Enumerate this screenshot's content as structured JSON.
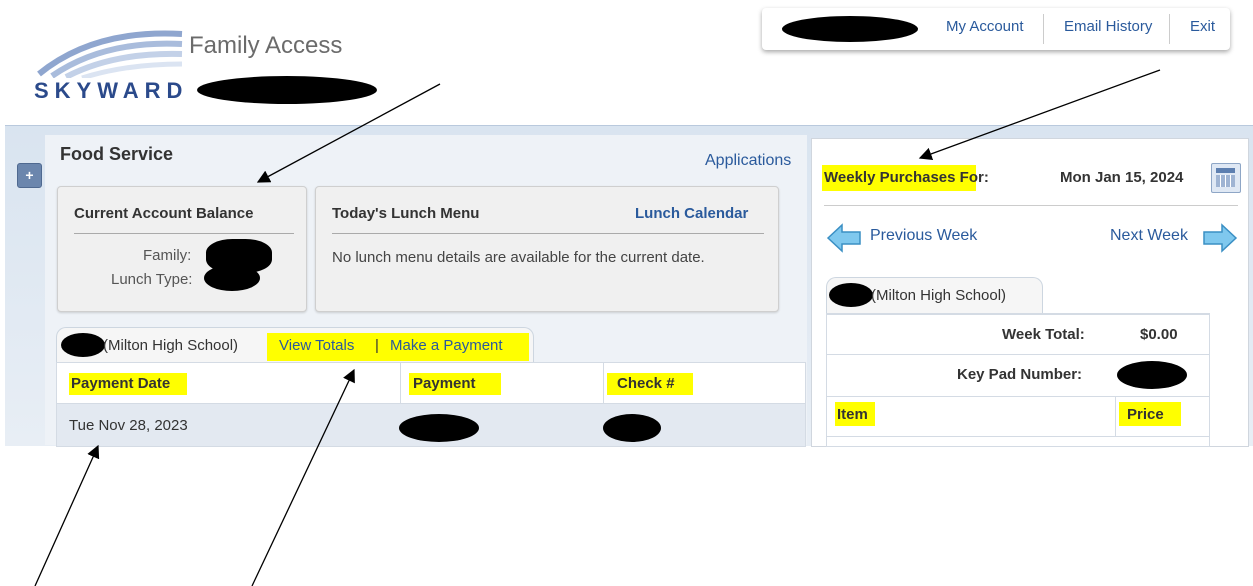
{
  "top_nav": {
    "my_account": "My Account",
    "email_history": "Email History",
    "exit": "Exit"
  },
  "brand": {
    "title": "Family Access",
    "logo": "SKYWARD"
  },
  "food_service": {
    "title": "Food Service",
    "applications_link": "Applications",
    "balance_card": {
      "title": "Current Account Balance",
      "family_label": "Family:",
      "lunch_type_label": "Lunch Type:"
    },
    "menu_card": {
      "title": "Today's Lunch Menu",
      "calendar_link": "Lunch Calendar",
      "message": "No lunch menu details are available for the current date."
    },
    "payment_tab": {
      "school": "(Milton High School)",
      "view_totals": "View Totals",
      "separator": "|",
      "make_payment": "Make a Payment"
    },
    "payment_table": {
      "columns": [
        "Payment Date",
        "Payment",
        "Check #"
      ],
      "rows": [
        {
          "date": "Tue Nov 28, 2023"
        }
      ]
    }
  },
  "weekly": {
    "title_highlight": "Weekly Purchases",
    "title_rest": " For:",
    "date": "Mon Jan 15, 2024",
    "prev_week": "Previous Week",
    "next_week": "Next Week",
    "school_tab": "(Milton High School)",
    "week_total_label": "Week Total:",
    "week_total_value": "$0.00",
    "keypad_label": "Key Pad Number:",
    "columns": [
      "Item",
      "Price"
    ]
  },
  "colors": {
    "link": "#2a5a9c",
    "highlight": "#ffff00",
    "band": "#d9e4f0"
  },
  "icons": [
    "plus-icon",
    "calendar-icon",
    "arrow-left-icon",
    "arrow-right-icon",
    "skyward-logo-swoosh"
  ]
}
